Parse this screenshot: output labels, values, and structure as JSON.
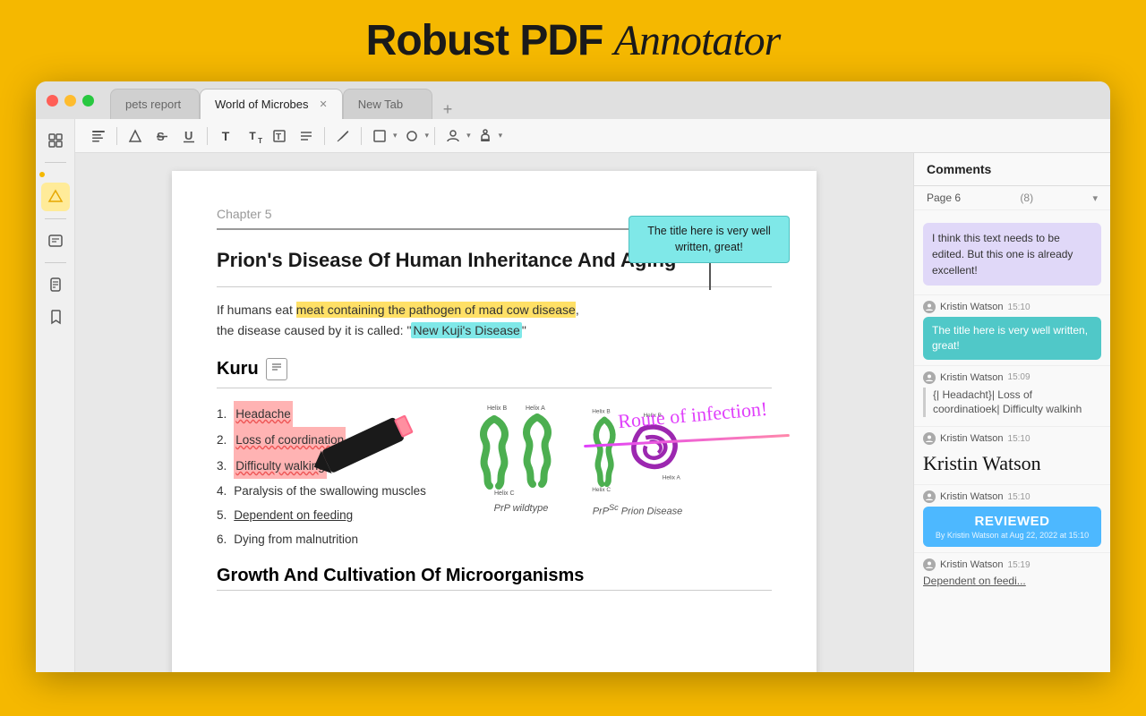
{
  "app": {
    "title_normal": "Robust PDF ",
    "title_italic": "Annotator"
  },
  "tabs": [
    {
      "id": "tab-pets",
      "label": "pets report",
      "active": false
    },
    {
      "id": "tab-microbes",
      "label": "World of Microbes",
      "active": true
    },
    {
      "id": "tab-new",
      "label": "New Tab",
      "active": false
    }
  ],
  "toolbar": {
    "buttons": [
      {
        "name": "text-tool",
        "icon": "≡"
      },
      {
        "name": "highlight-tool",
        "icon": "◇"
      },
      {
        "name": "strikethrough-tool",
        "icon": "S̶"
      },
      {
        "name": "underline-tool",
        "icon": "U̲"
      },
      {
        "name": "text-format",
        "icon": "T"
      },
      {
        "name": "text-size",
        "icon": "T"
      },
      {
        "name": "text-box",
        "icon": "⊞"
      },
      {
        "name": "list-tool",
        "icon": "☰"
      },
      {
        "name": "pen-tool",
        "icon": "∧"
      },
      {
        "name": "shape-tool",
        "icon": "⬜"
      },
      {
        "name": "polygon-tool",
        "icon": "⬠"
      },
      {
        "name": "person-tool",
        "icon": "👤"
      },
      {
        "name": "stamp-tool",
        "icon": "⬆"
      }
    ]
  },
  "sidebar": {
    "icons": [
      {
        "name": "pages-icon",
        "symbol": "⊞",
        "active": false
      },
      {
        "name": "highlight-sidebar-icon",
        "symbol": "◁",
        "active": true
      },
      {
        "name": "annotations-icon",
        "symbol": "📋",
        "active": false
      },
      {
        "name": "attachments-icon",
        "symbol": "📄",
        "active": false
      },
      {
        "name": "bookmarks-icon",
        "symbol": "🔖",
        "active": false
      }
    ]
  },
  "pdf": {
    "chapter": "Chapter 5",
    "callout_text": "The title here is very well written, great!",
    "main_title": "Prion's Disease Of Human Inheritance And Aging",
    "paragraph1": "If humans eat meat containing the pathogen of mad cow disease, the disease caused by it is called: \"New Kuji's Disease\"",
    "route_annotation": "Route of infection!",
    "kuru_title": "Kuru",
    "symptoms": [
      {
        "number": "1.",
        "text": "Headache",
        "style": "pink"
      },
      {
        "number": "2.",
        "text": "Loss of coordination",
        "style": "pink"
      },
      {
        "number": "3.",
        "text": "Difficulty walking",
        "style": "pink"
      },
      {
        "number": "4.",
        "text": "Paralysis of the swallowing muscles",
        "style": "normal"
      },
      {
        "number": "5.",
        "text": "Dependent on feeding",
        "style": "underline"
      },
      {
        "number": "6.",
        "text": "Dying from malnutrition",
        "style": "normal"
      }
    ],
    "protein1_label": "PrP wildtype",
    "protein2_label": "PrP^Sc Prion Disease",
    "growth_title": "Growth And Cultivation Of Microorganisms"
  },
  "comments": {
    "header": "Comments",
    "page_label": "Page 6",
    "page_count": "(8)",
    "items": [
      {
        "id": "comment-1",
        "type": "text-input",
        "text": "I think this text needs to be edited. But this one is already excellent!",
        "style": "purple-bubble"
      },
      {
        "id": "comment-2",
        "type": "teal",
        "author": "Kristin Watson",
        "time": "15:10",
        "text": "The title here is very well written, great!",
        "icon": "document"
      },
      {
        "id": "comment-3",
        "type": "reply",
        "author": "Kristin Watson",
        "time": "15:09",
        "text": "{| Headacht}| Loss of coordinatioek| Difficulty walkinh",
        "icon": "person"
      },
      {
        "id": "comment-4",
        "type": "signature",
        "author": "Kristin Watson",
        "time": "15:10",
        "text": "Kristin Watson",
        "icon": "person"
      },
      {
        "id": "comment-5",
        "type": "reviewed",
        "author": "Kristin Watson",
        "time": "15:10",
        "label": "REVIEWED",
        "sublabel": "By Kristin Watson at Aug 22, 2022 at 15:10",
        "icon": "person"
      },
      {
        "id": "comment-6",
        "type": "underline",
        "author": "Kristin Watson",
        "time": "15:19",
        "text": "Dependent on feedi...",
        "icon": "underline"
      }
    ]
  }
}
